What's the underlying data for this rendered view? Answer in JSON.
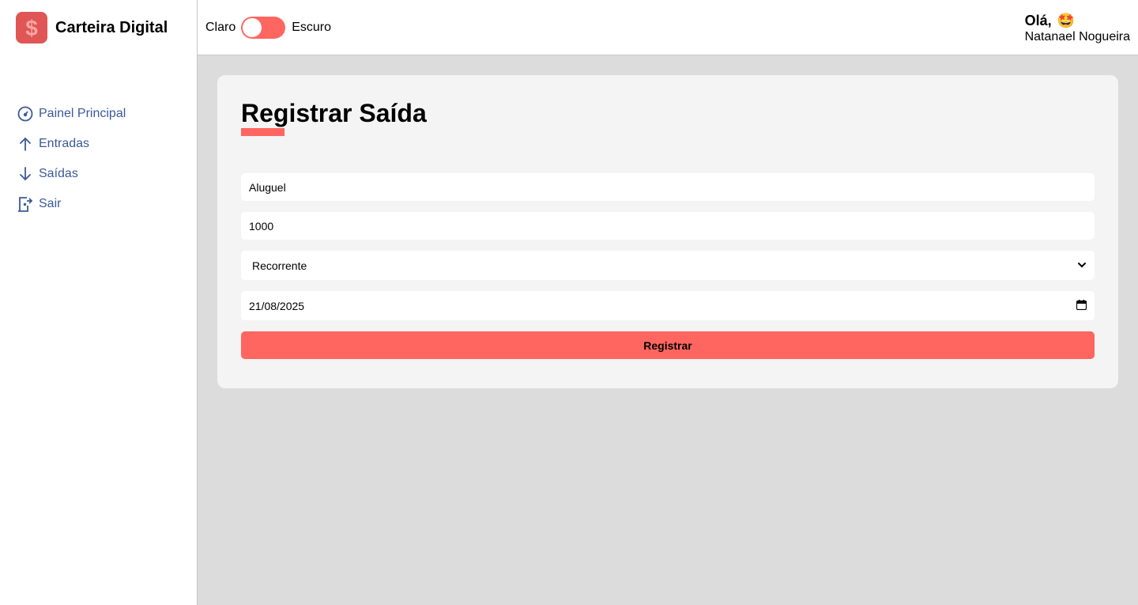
{
  "app": {
    "title": "Carteira Digital",
    "logo_icon": "dollar-sign-icon",
    "accent": "#ff6660"
  },
  "sidebar": {
    "items": [
      {
        "label": "Painel Principal",
        "icon": "dashboard-gauge-icon"
      },
      {
        "label": "Entradas",
        "icon": "arrow-up-icon"
      },
      {
        "label": "Saídas",
        "icon": "arrow-down-icon"
      },
      {
        "label": "Sair",
        "icon": "exit-door-icon"
      }
    ]
  },
  "header": {
    "theme_light_label": "Claro",
    "theme_dark_label": "Escuro",
    "greeting": "Olá,",
    "greeting_emoji": "🤩",
    "user_name": "Natanael Nogueira"
  },
  "form": {
    "title": "Registrar Saída",
    "description_value": "Aluguel",
    "amount_value": "1000",
    "frequency_selected": "Recorrente",
    "date_value": "21/08/2025",
    "submit_label": "Registrar"
  }
}
